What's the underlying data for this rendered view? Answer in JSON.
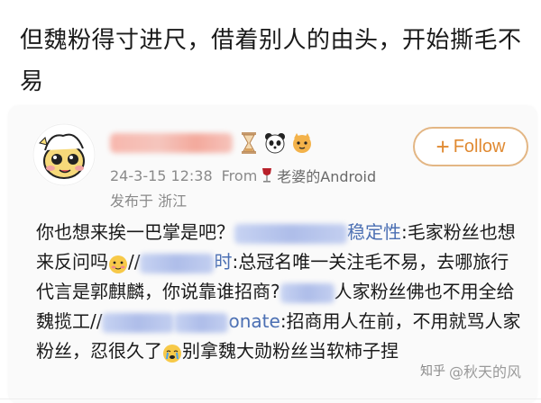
{
  "headline": "但魏粉得寸进尺，借着别人的由头，开始撕毛不易",
  "post": {
    "follow_label": "Follow",
    "follow_plus": "+",
    "date": "24-3-15 12:38",
    "from_label": "From",
    "device": "老婆的Android",
    "location": "发布于 浙江",
    "body": {
      "p1": "你也想来挨一巴掌是吧？",
      "m1": "稳定性",
      "p2": ":毛家粉丝也想来反问吗",
      "p3": "//",
      "m2": "时",
      "p4": ":总冠名唯一关注毛不易，去哪旅行代言是郭麒麟，你说靠谁招商?",
      "p5": "人家粉丝佛也不用全给魏揽工//",
      "m3": "onate",
      "p6": ":招商用人在前，不用就骂人家粉丝，忍很久了",
      "p7": "别拿魏大勋粉丝当软柿子",
      "p8": "捏"
    }
  },
  "watermark": {
    "site": "知乎",
    "author": "@秋天的风"
  },
  "colors": {
    "follow_border": "#e3b684",
    "follow_text": "#e08a32",
    "mention": "#4b6fb3"
  },
  "icons": [
    "avatar-illustration",
    "hourglass-icon",
    "panda-icon",
    "cat-icon",
    "wine-glass-icon",
    "emoji-shy",
    "emoji-cry",
    "zhihu-icon"
  ]
}
